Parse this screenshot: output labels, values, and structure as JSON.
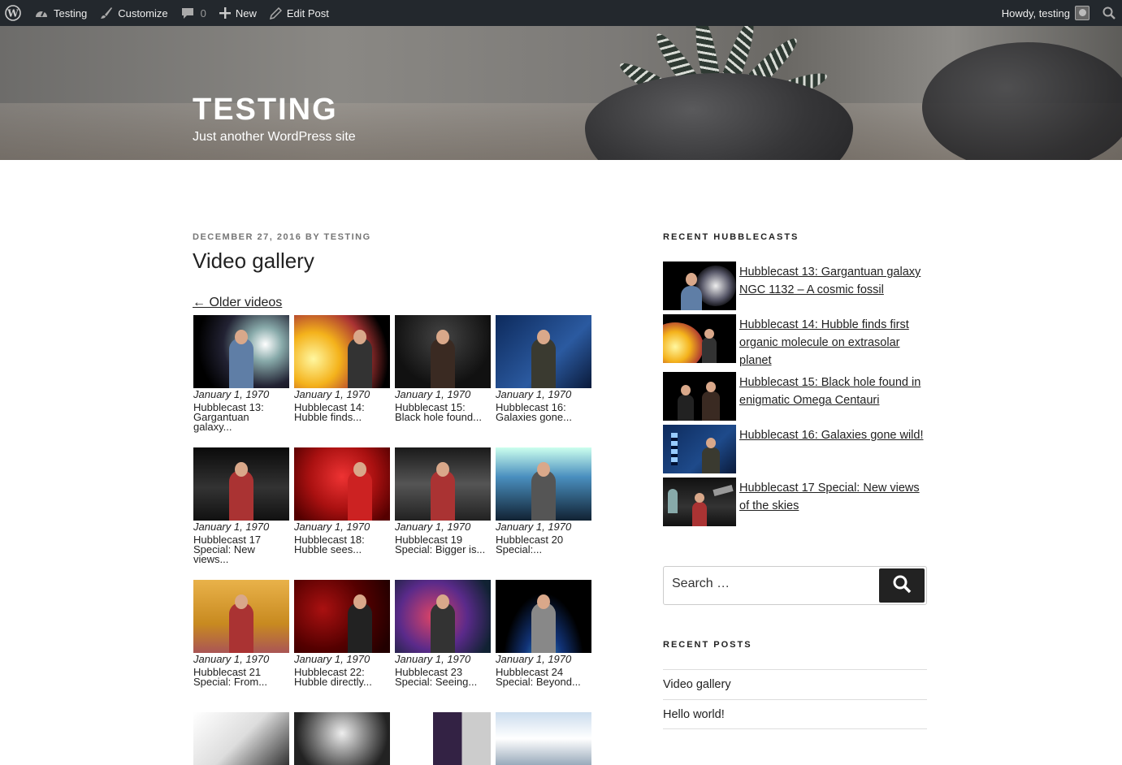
{
  "adminbar": {
    "site_name": "Testing",
    "customize": "Customize",
    "comments_count": "0",
    "new": "New",
    "edit_post": "Edit Post",
    "howdy": "Howdy, testing"
  },
  "header": {
    "title": "TESTING",
    "description": "Just another WordPress site"
  },
  "post": {
    "meta": "DECEMBER 27, 2016 BY TESTING",
    "title": "Video gallery",
    "older_link": "← Older videos"
  },
  "gallery": [
    {
      "date": "January 1, 1970",
      "caption": "Hubblecast 13: Gargantuan galaxy..."
    },
    {
      "date": "January 1, 1970",
      "caption": "Hubblecast 14: Hubble finds..."
    },
    {
      "date": "January 1, 1970",
      "caption": "Hubblecast 15: Black hole found..."
    },
    {
      "date": "January 1, 1970",
      "caption": "Hubblecast 16: Galaxies gone..."
    },
    {
      "date": "January 1, 1970",
      "caption": "Hubblecast 17 Special: New views..."
    },
    {
      "date": "January 1, 1970",
      "caption": "Hubblecast 18: Hubble sees..."
    },
    {
      "date": "January 1, 1970",
      "caption": "Hubblecast 19 Special: Bigger is..."
    },
    {
      "date": "January 1, 1970",
      "caption": "Hubblecast 20 Special:..."
    },
    {
      "date": "January 1, 1970",
      "caption": "Hubblecast 21 Special: From..."
    },
    {
      "date": "January 1, 1970",
      "caption": "Hubblecast 22: Hubble directly..."
    },
    {
      "date": "January 1, 1970",
      "caption": "Hubblecast 23 Special: Seeing..."
    },
    {
      "date": "January 1, 1970",
      "caption": "Hubblecast 24 Special: Beyond..."
    }
  ],
  "sidebar": {
    "recent_hubblecasts_title": "RECENT HUBBLECASTS",
    "hubblecasts": [
      "Hubblecast 13: Gargantuan galaxy NGC 1132 – A cosmic fossil",
      "Hubblecast 14: Hubble finds first organic molecule on extrasolar planet",
      "Hubblecast 15: Black hole found in enigmatic Omega Centauri",
      "Hubblecast 16: Galaxies gone wild!",
      "Hubblecast 17 Special: New views of the skies"
    ],
    "search_placeholder": "Search …",
    "recent_posts_title": "RECENT POSTS",
    "recent_posts": [
      "Video gallery",
      "Hello world!"
    ]
  }
}
